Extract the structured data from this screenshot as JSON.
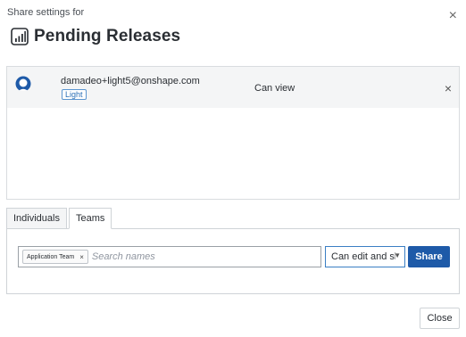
{
  "dialog": {
    "subtitle": "Share settings for",
    "title": "Pending Releases",
    "close_icon": "close-icon",
    "doc_icon": "release-chart-icon"
  },
  "share_list": {
    "entries": [
      {
        "email": "damadeo+light5@onshape.com",
        "badge": "Light",
        "permission": "Can view",
        "avatar_icon": "user-avatar-icon",
        "remove_icon": "close-icon"
      }
    ]
  },
  "tabs": [
    {
      "label": "Individuals",
      "active": false
    },
    {
      "label": "Teams",
      "active": true
    }
  ],
  "teams_panel": {
    "chips": [
      {
        "label": "Application Team",
        "remove": "×"
      }
    ],
    "search_placeholder": "Search names",
    "permission_selected": "Can edit and sl",
    "share_label": "Share"
  },
  "footer": {
    "close_label": "Close"
  },
  "colors": {
    "primary_button": "#1e5aa8",
    "avatar": "#1e5aa8",
    "badge": "#2a6fb6",
    "row_highlight": "#f4f5f6"
  }
}
